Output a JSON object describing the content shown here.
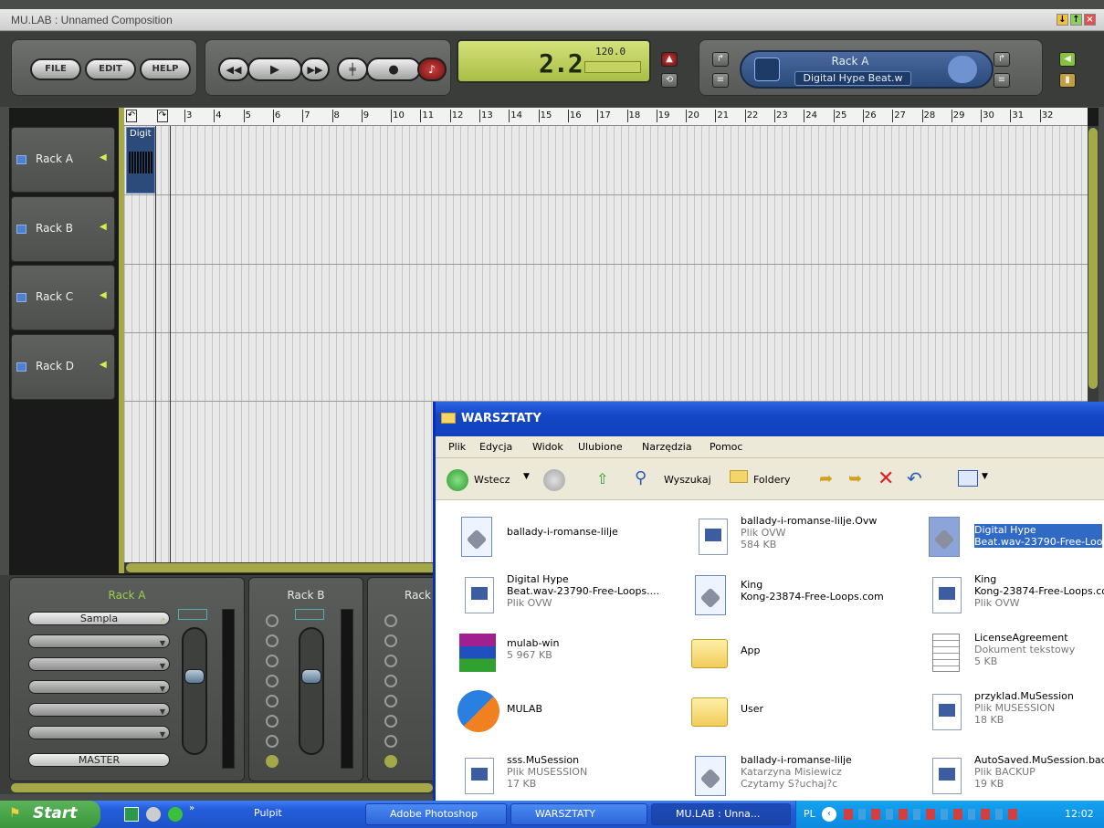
{
  "window": {
    "title": "MU.LAB : Unnamed Composition"
  },
  "topbar": {
    "file_label": "FILE",
    "edit_label": "EDIT",
    "help_label": "HELP",
    "position": "2.2",
    "tempo": "120.0",
    "rack_name": "Rack A",
    "rack_sample": "Digital Hype Beat.w"
  },
  "ruler": {
    "marks": [
      "3",
      "4",
      "5",
      "6",
      "7",
      "8",
      "9",
      "10",
      "11",
      "12",
      "13",
      "14",
      "15",
      "16",
      "17",
      "18",
      "19",
      "20",
      "21",
      "22",
      "23",
      "24",
      "25",
      "26",
      "27",
      "28",
      "29",
      "30",
      "31",
      "32"
    ]
  },
  "tracks": [
    {
      "label": "Rack A"
    },
    {
      "label": "Rack B"
    },
    {
      "label": "Rack C"
    },
    {
      "label": "Rack D"
    }
  ],
  "clip": {
    "label": "Digit"
  },
  "mixer": {
    "rack_a": {
      "name": "Rack A",
      "slot1": "Sampla",
      "master": "MASTER"
    },
    "rack_b": {
      "name": "Rack B"
    },
    "rack_c": {
      "name": "Rack"
    }
  },
  "explorer": {
    "title": "WARSZTATY",
    "menu": [
      "Plik",
      "Edycja",
      "Widok",
      "Ulubione",
      "Narzędzia",
      "Pomoc"
    ],
    "toolbar": {
      "back": "Wstecz",
      "search": "Wyszukaj",
      "folders": "Foldery"
    },
    "files": [
      {
        "name": "ballady-i-romanse-lilje",
        "l2": "",
        "l3": ""
      },
      {
        "name": "ballady-i-romanse-lilje.Ovw",
        "l2": "Plik OVW",
        "l3": "584 KB"
      },
      {
        "name": "Digital Hype",
        "l2": "Beat.wav-23790-Free-Loo",
        "l3": ""
      },
      {
        "name": "Digital Hype",
        "l2": "Beat.wav-23790-Free-Loops....",
        "l3": "Plik OVW"
      },
      {
        "name": "King",
        "l2": "Kong-23874-Free-Loops.com",
        "l3": ""
      },
      {
        "name": "King",
        "l2": "Kong-23874-Free-Loops.co",
        "l3": "Plik OVW"
      },
      {
        "name": "mulab-win",
        "l2": "5 967 KB",
        "l3": ""
      },
      {
        "name": "App",
        "l2": "",
        "l3": ""
      },
      {
        "name": "LicenseAgreement",
        "l2": "Dokument tekstowy",
        "l3": "5 KB"
      },
      {
        "name": "MULAB",
        "l2": "",
        "l3": ""
      },
      {
        "name": "User",
        "l2": "",
        "l3": ""
      },
      {
        "name": "przyklad.MuSession",
        "l2": "Plik MUSESSION",
        "l3": "18 KB"
      },
      {
        "name": "sss.MuSession",
        "l2": "Plik MUSESSION",
        "l3": "17 KB"
      },
      {
        "name": "ballady-i-romanse-lilje",
        "l2": "Katarzyna Misiewicz",
        "l3": "Czytamy S?uchaj?c"
      },
      {
        "name": "AutoSaved.MuSession.bac",
        "l2": "Plik BACKUP",
        "l3": "19 KB"
      }
    ]
  },
  "taskbar": {
    "start": "Start",
    "pulpit": "Pulpit",
    "photoshop": "Adobe Photoshop",
    "warsztaty": "WARSZTATY",
    "mulab": "MU.LAB : Unna...",
    "lang": "PL",
    "time": "12:02"
  },
  "colors": {
    "lcd": "#c4d35f",
    "accent_green": "#a4a848",
    "rack_blue": "#2a4a7a",
    "xp_blue": "#245edb"
  }
}
